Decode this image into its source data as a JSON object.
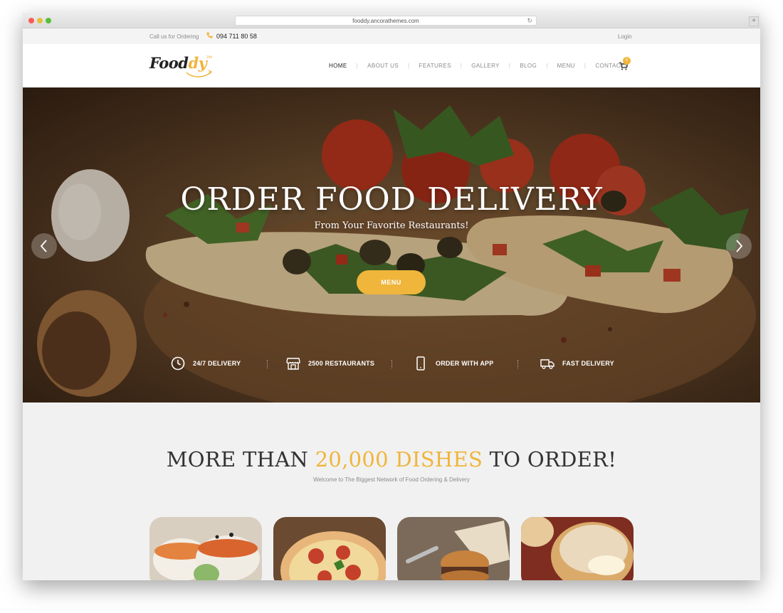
{
  "browser": {
    "url": "fooddy.ancorathemes.com",
    "new_tab_label": "+"
  },
  "topbar": {
    "call_label": "Call us for Ordering",
    "phone": "094 711 80 58",
    "login": "Login"
  },
  "header": {
    "logo": {
      "part1": "Food",
      "part2": "dy",
      "badge": "24h"
    },
    "nav": [
      {
        "label": "HOME",
        "active": true
      },
      {
        "label": "ABOUT US",
        "active": false
      },
      {
        "label": "FEATURES",
        "active": false
      },
      {
        "label": "GALLERY",
        "active": false
      },
      {
        "label": "BLOG",
        "active": false
      },
      {
        "label": "MENU",
        "active": false
      },
      {
        "label": "CONTACTS",
        "active": false
      }
    ],
    "cart_count": "0"
  },
  "hero": {
    "title": "ORDER FOOD DELIVERY",
    "subtitle": "From Your Favorite Restaurants!",
    "button": "MENU",
    "features": [
      {
        "icon": "clock-icon",
        "label": "24/7 DELIVERY"
      },
      {
        "icon": "store-icon",
        "label": "2500 RESTAURANTS"
      },
      {
        "icon": "phone-icon",
        "label": "ORDER WITH APP"
      },
      {
        "icon": "truck-icon",
        "label": "FAST DELIVERY"
      }
    ]
  },
  "section": {
    "title_pre": "MORE THAN ",
    "title_highlight": "20,000 DISHES",
    "title_post": " TO ORDER!",
    "subtitle": "Welcome to The Biggest Network of Food Ordering & Delivery",
    "cards": [
      {
        "name": "sushi"
      },
      {
        "name": "pizza"
      },
      {
        "name": "burger"
      },
      {
        "name": "cream-puff"
      }
    ]
  },
  "colors": {
    "accent": "#f0b53b",
    "text_dark": "#222222",
    "text_muted": "#8a8a8a",
    "section_bg": "#f1f1f1"
  }
}
